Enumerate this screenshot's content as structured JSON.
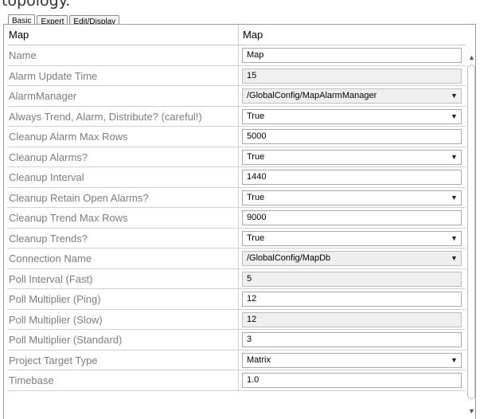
{
  "caption": "topology.",
  "tabs": [
    {
      "label": "Basic",
      "active": true
    },
    {
      "label": "Expert",
      "active": false
    },
    {
      "label": "Edit/Display",
      "active": false
    }
  ],
  "header": {
    "left": "Map",
    "right": "Map"
  },
  "rows": [
    {
      "name": "Name",
      "value": "Map",
      "kind": "text"
    },
    {
      "name": "Alarm Update Time",
      "value": "15",
      "kind": "readonly"
    },
    {
      "name": "AlarmManager",
      "value": "/GlobalConfig/MapAlarmManager",
      "kind": "dropdown-readonly"
    },
    {
      "name": "Always Trend, Alarm, Distribute? (careful!)",
      "value": "True",
      "kind": "dropdown"
    },
    {
      "name": "Cleanup Alarm Max Rows",
      "value": "5000",
      "kind": "text"
    },
    {
      "name": "Cleanup Alarms?",
      "value": "True",
      "kind": "dropdown"
    },
    {
      "name": "Cleanup Interval",
      "value": "1440",
      "kind": "text"
    },
    {
      "name": "Cleanup Retain Open Alarms?",
      "value": "True",
      "kind": "dropdown"
    },
    {
      "name": "Cleanup Trend Max Rows",
      "value": "9000",
      "kind": "text"
    },
    {
      "name": "Cleanup Trends?",
      "value": "True",
      "kind": "dropdown"
    },
    {
      "name": "Connection Name",
      "value": "/GlobalConfig/MapDb",
      "kind": "dropdown-readonly"
    },
    {
      "name": "Poll Interval (Fast)",
      "value": "5",
      "kind": "readonly"
    },
    {
      "name": "Poll Multiplier (Ping)",
      "value": "12",
      "kind": "text"
    },
    {
      "name": "Poll Multiplier (Slow)",
      "value": "12",
      "kind": "readonly"
    },
    {
      "name": "Poll Multiplier (Standard)",
      "value": "3",
      "kind": "text"
    },
    {
      "name": "Project Target Type",
      "value": "Matrix",
      "kind": "dropdown"
    },
    {
      "name": "Timebase",
      "value": "1.0",
      "kind": "text"
    }
  ],
  "icons": {
    "dropdown": "chevron-down-icon",
    "scroll_up": "scroll-up-icon",
    "scroll_down": "scroll-down-icon"
  }
}
